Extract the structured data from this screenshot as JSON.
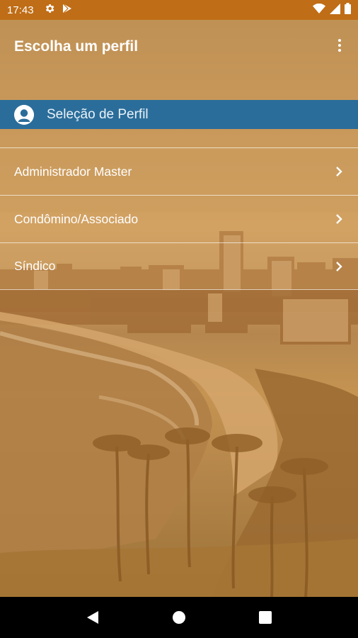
{
  "status_bar": {
    "time": "17:43",
    "left_icons": [
      "gear-icon",
      "play-store-icon"
    ],
    "right_icons": [
      "wifi-icon",
      "signal-icon",
      "battery-icon"
    ],
    "color": "#bf6d16"
  },
  "app_bar": {
    "title": "Escolha um perfil",
    "overflow_icon": "more-vert-icon"
  },
  "section": {
    "title": "Seleção de Perfil",
    "icon": "person-icon",
    "color": "#2b6d9a"
  },
  "profiles": [
    {
      "label": "Administrador Master",
      "icon": "chevron-right-icon"
    },
    {
      "label": "Condômino/Associado",
      "icon": "chevron-right-icon"
    },
    {
      "label": "Síndico",
      "icon": "chevron-right-icon"
    }
  ],
  "nav_bar": {
    "buttons": [
      "back-icon",
      "home-icon",
      "recents-icon"
    ]
  }
}
